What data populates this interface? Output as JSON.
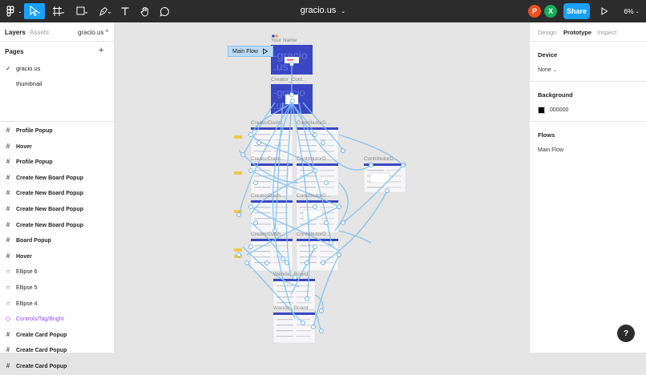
{
  "toolbar": {
    "file_name": "gracio.us",
    "zoom": "6%",
    "share_label": "Share",
    "tools": [
      "figma-menu-icon",
      "move-tool-icon",
      "frame-tool-icon",
      "shape-tool-icon",
      "pen-tool-icon",
      "text-tool-icon",
      "hand-tool-icon",
      "comment-tool-icon"
    ],
    "avatars": [
      {
        "initial": "P",
        "color": "#f24e1e"
      },
      {
        "initial": "X",
        "color": "#14ae5c"
      }
    ]
  },
  "left_panel": {
    "tabs": {
      "layers": "Layers",
      "assets": "Assets"
    },
    "page_selector": "gracio.us ^",
    "pages_title": "Pages",
    "pages": [
      {
        "label": "gracio.us",
        "selected": true
      },
      {
        "label": "thumbnail",
        "selected": false
      }
    ],
    "layers": [
      {
        "label": "Profile Popup",
        "type": "frame"
      },
      {
        "label": "Hover",
        "type": "frame"
      },
      {
        "label": "Profile Popup",
        "type": "frame"
      },
      {
        "label": "Create New Board Popup",
        "type": "frame"
      },
      {
        "label": "Create New Board Popup",
        "type": "frame"
      },
      {
        "label": "Create New Board Popup",
        "type": "frame"
      },
      {
        "label": "Create New Board Popup",
        "type": "frame"
      },
      {
        "label": "Board Popup",
        "type": "frame"
      },
      {
        "label": "Hover",
        "type": "frame"
      },
      {
        "label": "Ellipse 6",
        "type": "ellipse"
      },
      {
        "label": "Ellipse 5",
        "type": "ellipse"
      },
      {
        "label": "Ellipse 4",
        "type": "ellipse"
      },
      {
        "label": "Controls/Tag/Bright",
        "type": "component"
      },
      {
        "label": "Create Card Popup",
        "type": "frame"
      },
      {
        "label": "Create Card Popup",
        "type": "frame"
      },
      {
        "label": "Create Card Popup",
        "type": "frame"
      }
    ]
  },
  "right_panel": {
    "tabs": {
      "design": "Design",
      "prototype": "Prototype",
      "inspect": "Inspect"
    },
    "device_title": "Device",
    "device_value": "None",
    "background_title": "Background",
    "background_hex": "000000",
    "background_color": "#000000",
    "flows_title": "Flows",
    "flow_name": "Main Flow"
  },
  "canvas": {
    "flow_tag": "Main Flow",
    "frame_labels": {
      "your_name": "Your Name",
      "creator_cont": "Creator_Cont...",
      "creator_dash_1": "CreatorDash...",
      "contributor_d_1": "ContributorD...",
      "creator_dash_2": "CreatorDash...",
      "contributor_d_2": "ContributorD...",
      "contributor_d_side": "ContributorD...",
      "creator_dash_3": "CreatorDash...",
      "contributor_d_3": "ContributorD...",
      "creator_dash_4": "CreatorDash...",
      "contributor_d_4": "ContributorD...",
      "wanda_board_1": "Wanda...Board",
      "wanda_board_2": "Wanda...Board"
    },
    "frame_title_partial": "gracio .us"
  },
  "help_label": "?"
}
